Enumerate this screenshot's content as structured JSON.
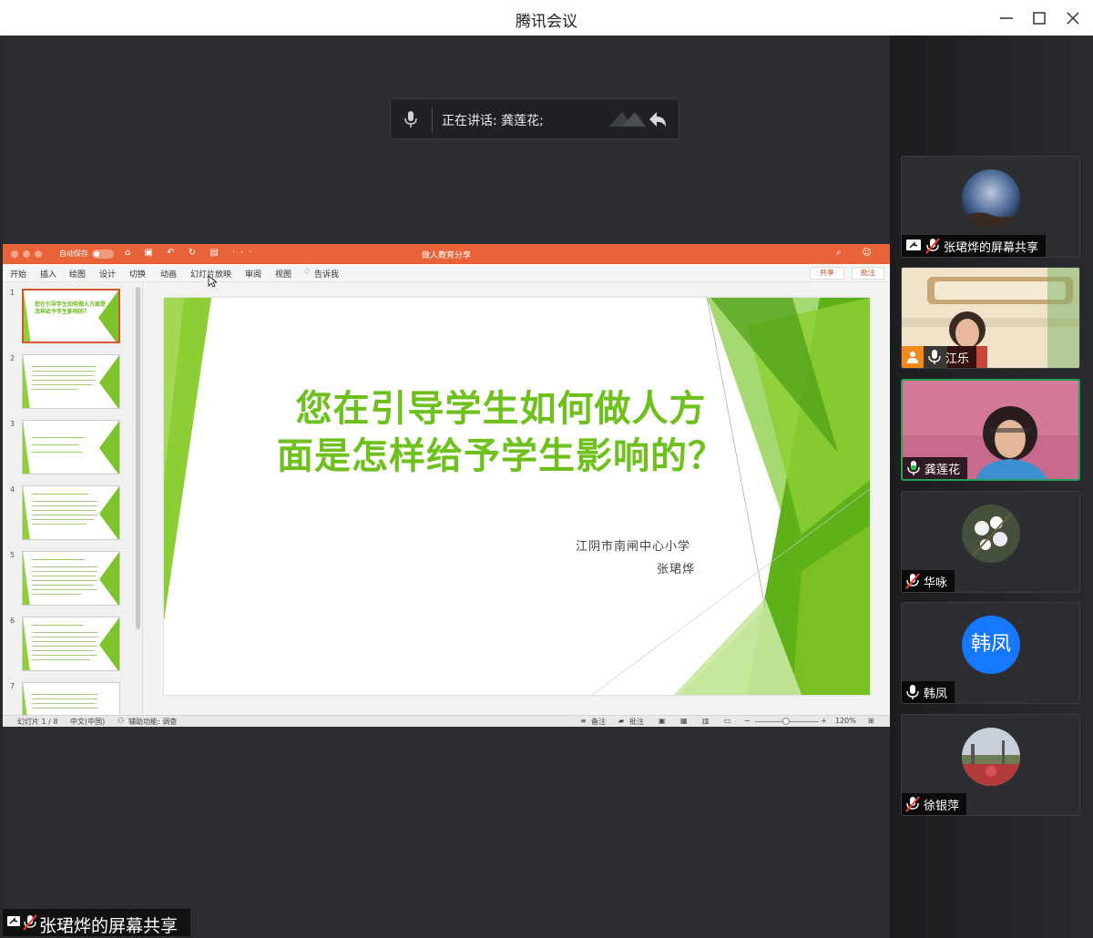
{
  "window": {
    "title": "腾讯会议"
  },
  "speaking_bar": {
    "text": "正在讲话: 龚莲花;"
  },
  "ppt": {
    "autosave_label": "自动保存",
    "toggle_label": "关闭",
    "doc_title": "做人教育分享",
    "ribbon_tabs": [
      "开始",
      "插入",
      "绘图",
      "设计",
      "切换",
      "动画",
      "幻灯片放映",
      "审阅",
      "视图",
      "告诉我"
    ],
    "share_label": "共享",
    "comment_label": "批注",
    "thumbnails": [
      {
        "num": "1",
        "title": "您在引导学生如何做人方面是怎样给予学生影响的？"
      },
      {
        "num": "2",
        "title": ""
      },
      {
        "num": "3",
        "title": ""
      },
      {
        "num": "4",
        "title": ""
      },
      {
        "num": "5",
        "title": ""
      },
      {
        "num": "6",
        "title": ""
      },
      {
        "num": "7",
        "title": ""
      }
    ],
    "slide": {
      "headline_line1": "您在引导学生如何做人方",
      "headline_line2": "面是怎样给予学生影响的？",
      "school": "江阴市南闸中心小学",
      "author": "张珺烨"
    },
    "status": {
      "slide_pos": "幻灯片 1 / 8",
      "language": "中文(中国)",
      "accessibility": "辅助功能: 调查",
      "notes": "备注",
      "comments": "批注",
      "zoom": "120%"
    }
  },
  "share_owner_label": "张珺烨的屏幕共享",
  "participants": [
    {
      "name": "张珺烨的屏幕共享",
      "icon": "screen-share-icon",
      "mic": "muted"
    },
    {
      "name": "江乐",
      "icon": "person-icon",
      "mic": "on"
    },
    {
      "name": "龚莲花",
      "icon": "",
      "mic": "on"
    },
    {
      "name": "华咏",
      "icon": "",
      "mic": "muted"
    },
    {
      "name": "韩凤",
      "icon": "",
      "mic": "on",
      "avatar_text": "韩凤"
    },
    {
      "name": "徐银萍",
      "icon": "",
      "mic": "muted"
    }
  ],
  "colors": {
    "ppt_accent": "#e9633a",
    "slide_green": "#6ec11d",
    "active_speaker": "#22a05a",
    "avatar_blue": "#1677ff"
  }
}
